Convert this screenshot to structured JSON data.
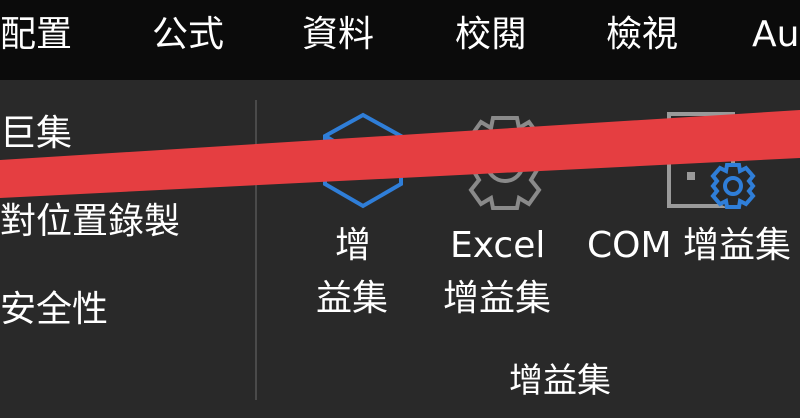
{
  "tabs": [
    "配置",
    "公式",
    "資料",
    "校閱",
    "檢視",
    "Au"
  ],
  "code_group": {
    "items": [
      "巨集",
      "對位置錄製",
      "安全性"
    ]
  },
  "addins_group": {
    "label": "增益集",
    "buttons": [
      {
        "label_line1": "增",
        "label_line2": "益集",
        "icon": "addins-hexagon-icon"
      },
      {
        "label_line1": "Excel",
        "label_line2": "增益集",
        "icon": "excel-addins-gear-icon"
      },
      {
        "label_line1": "COM 增益集",
        "icon": "com-addins-icon"
      }
    ]
  },
  "colors": {
    "tab_bar": "#0b0b0b",
    "ribbon": "#292929",
    "accent_blue": "#2f7ed8",
    "annotation_red": "#e53e41"
  }
}
